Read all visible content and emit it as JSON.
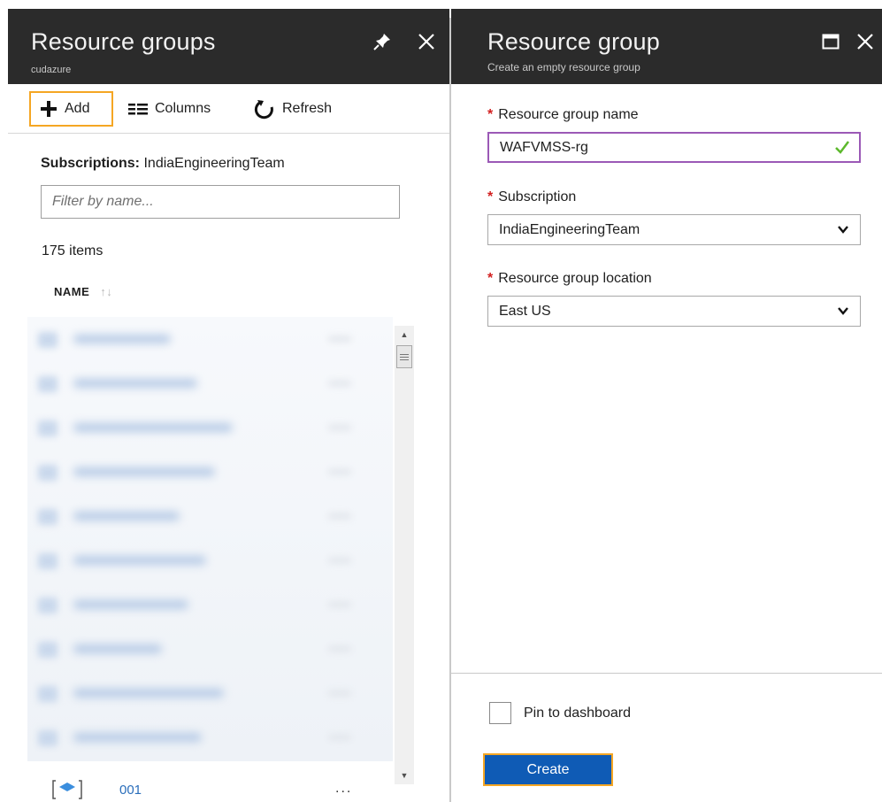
{
  "left_blade": {
    "title": "Resource groups",
    "subtitle": "cudazure",
    "toolbar": {
      "add_label": "Add",
      "columns_label": "Columns",
      "refresh_label": "Refresh"
    },
    "subscriptions_label": "Subscriptions:",
    "subscriptions_value": "IndiaEngineeringTeam",
    "filter_placeholder": "Filter by name...",
    "item_count": "175 items",
    "column_header": "NAME",
    "last_row_name": "001",
    "last_row_more": "..."
  },
  "right_blade": {
    "title": "Resource group",
    "subtitle": "Create an empty resource group",
    "required_marker": "*",
    "name_label": "Resource group name",
    "name_value": "WAFVMSS-rg",
    "subscription_label": "Subscription",
    "subscription_value": "IndiaEngineeringTeam",
    "location_label": "Resource group location",
    "location_value": "East US",
    "pin_label": "Pin to dashboard",
    "create_label": "Create"
  },
  "colors": {
    "header_bg": "#2b2b2b",
    "highlight": "#f5a623",
    "primary": "#0f5bb5",
    "valid": "#5cb82c",
    "required": "#d21f1f",
    "active_field": "#9b59b6"
  }
}
